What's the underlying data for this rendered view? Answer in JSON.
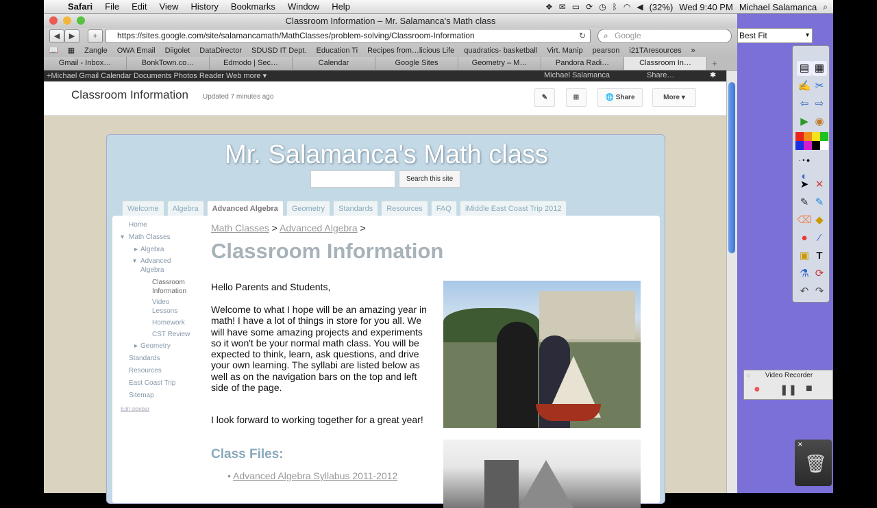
{
  "menubar": {
    "apple": "",
    "app": "Safari",
    "items": [
      "File",
      "Edit",
      "View",
      "History",
      "Bookmarks",
      "Window",
      "Help"
    ],
    "battery": "(32%)",
    "clock": "Wed 9:40 PM",
    "user": "Michael Salamanca"
  },
  "window": {
    "title": "Classroom Information – Mr. Salamanca's Math class",
    "url": "https://sites.google.com/site/salamancamath/MathClasses/problem-solving/Classroom-Information",
    "search_placeholder": "Google",
    "bookmarks": [
      "Zangle",
      "OWA Email",
      "Diigolet",
      "DataDirector",
      "SDUSD IT Dept.",
      "Education Ti",
      "Recipes from…licious Life",
      "quadratics- basketball",
      "Virt. Manip",
      "pearson",
      "i21TAresources"
    ],
    "tabs": [
      "Gmail - Inbox…",
      "BonkTown.co…",
      "Edmodo | Sec…",
      "Calendar",
      "Google Sites",
      "Geometry – M…",
      "Pandora Radi…",
      "Classroom In…"
    ],
    "active_tab": 7
  },
  "google_bar": {
    "links": "+Michael   Gmail   Calendar   Documents   Photos   Reader   Web   more ▾",
    "user": "Michael Salamanca",
    "share": "Share…"
  },
  "site_header": {
    "title": "Classroom Information",
    "updated": "Updated 7 minutes ago",
    "share_label": "Share",
    "more_label": "More"
  },
  "site": {
    "name": "Mr. Salamanca's Math class",
    "search_button": "Search this site",
    "nav_tabs": [
      "Welcome",
      "Algebra",
      "Advanced Algebra",
      "Geometry",
      "Standards",
      "Resources",
      "FAQ",
      "iMiddle East Coast Trip 2012"
    ],
    "active_nav": 2,
    "sidebar": {
      "home": "Home",
      "math_classes": "Math Classes",
      "algebra": "Algebra",
      "advanced_algebra_1": "Advanced",
      "advanced_algebra_2": "Algebra",
      "classroom_info_1": "Classroom",
      "classroom_info_2": "Information",
      "video_lessons_1": "Video",
      "video_lessons_2": "Lessons",
      "homework": "Homework",
      "cst_review": "CST Review",
      "geometry": "Geometry",
      "standards": "Standards",
      "resources": "Resources",
      "east_coast": "East Coast Trip",
      "sitemap": "Sitemap",
      "edit_sidebar": "Edit sidebar"
    },
    "breadcrumb": {
      "crumb1": "Math Classes",
      "sep": ">",
      "crumb2": "Advanced Algebra"
    },
    "page_heading": "Classroom Information",
    "greeting": "Hello Parents and Students,",
    "welcome": "Welcome to what I hope will be an amazing year in math!  I have a lot of things in store for you all.  We will have some amazing projects and experiments so it won't be your normal math class.  You will be expected to think, learn, ask questions, and drive your own learning.  The syllabi are listed below as well as on the navigation bars on the top and left side of the page.",
    "closing": "I look forward to working together for a great year!",
    "class_files_heading": "Class Files:",
    "syllabus_link": "Advanced Algebra Syllabus 2011-2012"
  },
  "right_panel": {
    "zoom": "Best Fit",
    "video_recorder_title": "Video Recorder",
    "palette": [
      "#e8231c",
      "#f28a1a",
      "#f5e11c",
      "#1ec01e",
      "#1c2ee0",
      "#d21ccf",
      "#000000",
      "#ffffff"
    ]
  }
}
